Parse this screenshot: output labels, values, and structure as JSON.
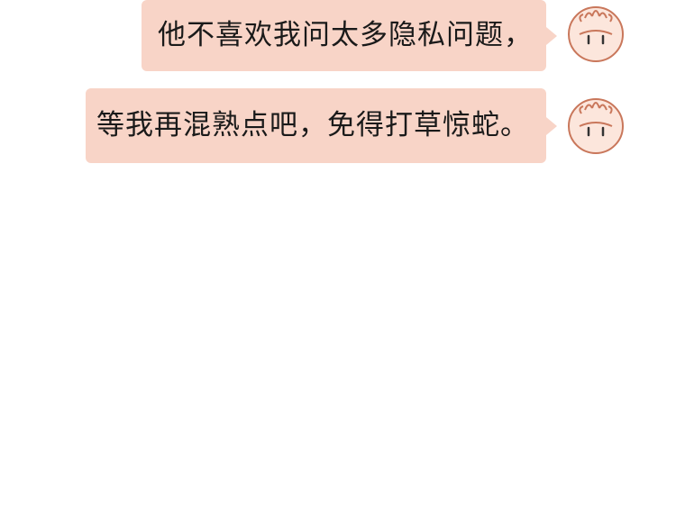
{
  "conversation": {
    "messages": [
      {
        "text": "他不喜欢我问太多隐私问题，",
        "avatar_icon": "tomato-face-icon"
      },
      {
        "text": "等我再混熟点吧，免得打草惊蛇。",
        "avatar_icon": "tomato-face-icon"
      }
    ]
  },
  "colors": {
    "bubble": "#f8d4c7",
    "avatar_fill": "#fce6dc",
    "avatar_outline": "#c9775b",
    "text": "#1a1a1a",
    "background": "#ffffff"
  }
}
